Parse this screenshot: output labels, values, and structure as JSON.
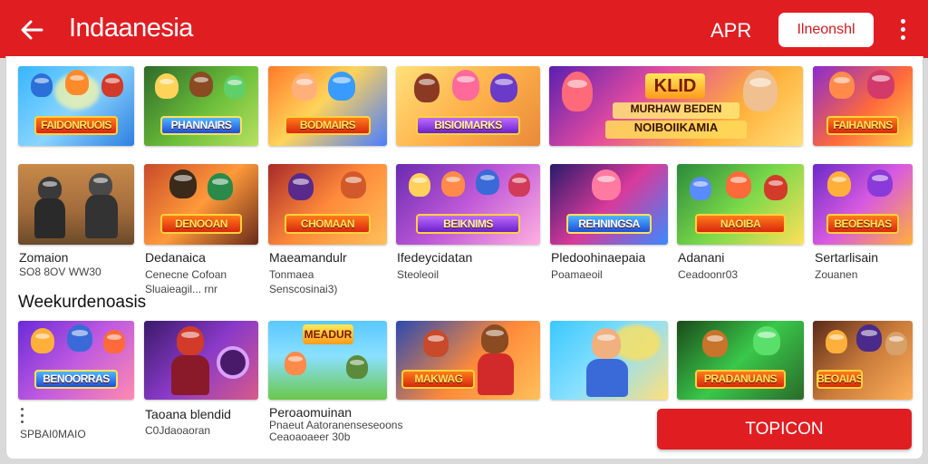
{
  "appbar": {
    "title": "Indaanesia",
    "apr_label": "APR",
    "lang_button": "Ilneonshl",
    "colors": {
      "bar": "#e01e22",
      "button_text": "#d11a1f"
    }
  },
  "row1": [
    {
      "banner": "FAIDONRUOIS"
    },
    {
      "banner": "PHANNAIRS"
    },
    {
      "banner": "BODMAIRS"
    },
    {
      "banner": "BISIOIMARKS"
    },
    {
      "banner": "KLID"
    },
    {
      "banner": "FAIHANRNS"
    }
  ],
  "row1_wide": {
    "line1": "MURHAW BEDEN",
    "line2": "NOIBOIIKAMIA"
  },
  "row2": [
    {
      "title": "Zomaion",
      "subtitle": "SO8 8OV WW30",
      "subtitle2": ""
    },
    {
      "title": "Dedanaica",
      "subtitle": "Cenecne Cofoan",
      "subtitle2": "Sluaieagil... rnr"
    },
    {
      "title": "Maeamandulr",
      "subtitle": "Tonmaea",
      "subtitle2": "Senscosinai3)"
    },
    {
      "title": "Ifedeycidatan",
      "subtitle": "Steoleoil",
      "subtitle2": ""
    },
    {
      "title": "Pledoohinaepaia",
      "subtitle": "Poamaeoil",
      "subtitle2": ""
    },
    {
      "title": "Adanani",
      "subtitle": "Ceadoonr03",
      "subtitle2": ""
    },
    {
      "title": "Sertarlisain",
      "subtitle": "Zouanen",
      "subtitle2": ""
    }
  ],
  "row2_banners": [
    "",
    "DENOOAN",
    "CHOMAAN",
    "BEIKNIMS",
    "REHNINGSA",
    "NAOIBA",
    "BEOESHAS"
  ],
  "section_title": "Weekurdenoasis",
  "row3": [
    {
      "banner": "BENOORRAS"
    },
    {
      "banner": ""
    },
    {
      "banner": "MEADUR"
    },
    {
      "banner": "MAKWAG"
    },
    {
      "banner": ""
    },
    {
      "banner": "PRADANUANS"
    },
    {
      "banner": "BEOAIAS"
    }
  ],
  "row3_captions": [
    {
      "title": "",
      "subtitle": "SPBAI0MAIO"
    },
    {
      "title": "Taoana blendid",
      "subtitle": "C0Jdaoaoran"
    },
    {
      "title": "Peroaomuinan",
      "subtitle": "Pnaeut Aatoranenseseoons",
      "subtitle2": "Ceaoaoaeer 30b"
    }
  ],
  "topicon_button": "TOPICON"
}
